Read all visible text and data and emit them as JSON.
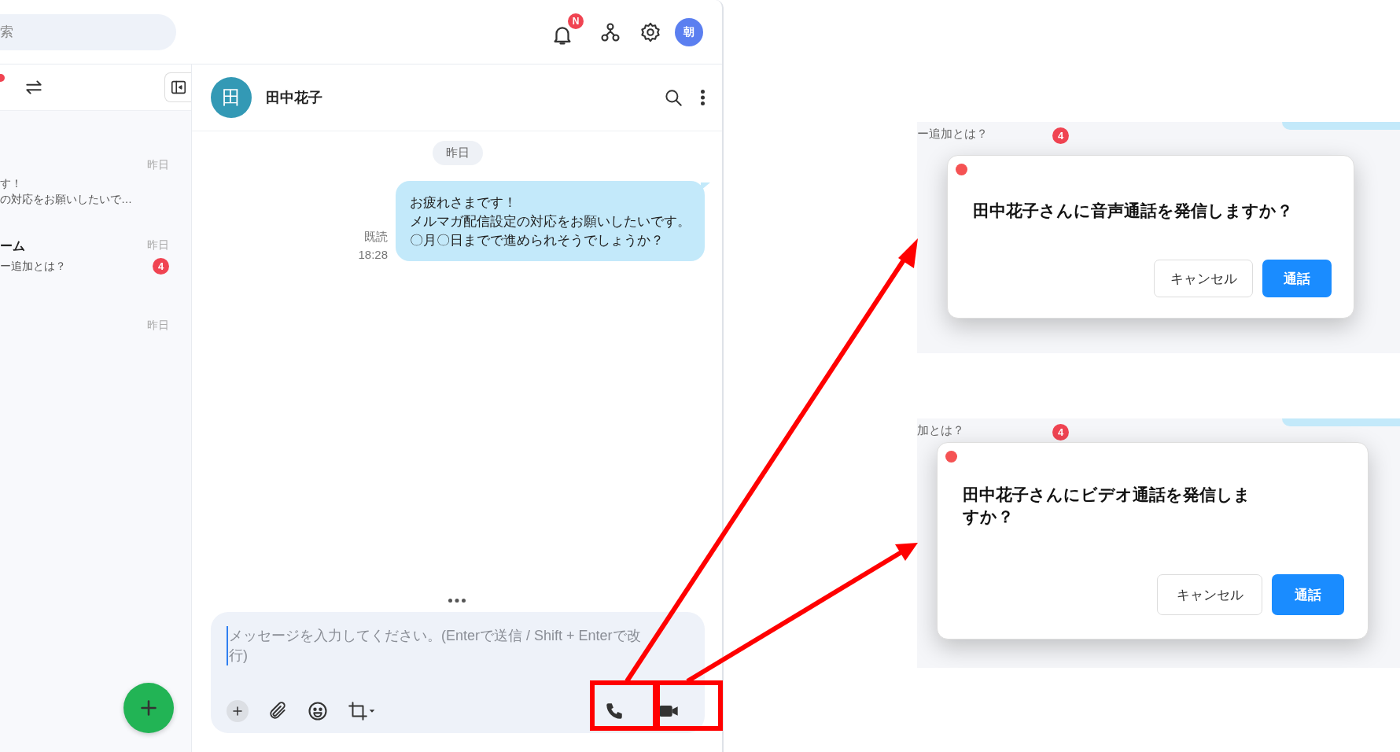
{
  "top_bar": {
    "search_placeholder": "索",
    "notification_badge": "N",
    "user_avatar": "朝"
  },
  "sidebar": {
    "conversations": [
      {
        "time": "昨日",
        "preview": [
          "す！",
          "の対応をお願いしたいで…"
        ]
      },
      {
        "name": "ーム",
        "time": "昨日",
        "preview": [
          "ー追加とは？"
        ],
        "unread": "4"
      },
      {
        "time": "昨日"
      }
    ]
  },
  "chat": {
    "name": "田中花子",
    "avatar": "田",
    "date_divider": "昨日",
    "messages": [
      {
        "read_status": "既読",
        "time": "18:28",
        "lines": [
          "お疲れさまです！",
          "メルマガ配信設定の対応をお願いしたいです。",
          "〇月〇日までで進められそうでしょうか？"
        ]
      }
    ],
    "composer": {
      "placeholder": "メッセージを入力してください。(Enterで送信 / Shift + Enterで改行)"
    }
  },
  "call_dialogs": [
    {
      "behind_preview": "ー追加とは？",
      "behind_badge": "4",
      "message": "田中花子さんに音声通話を発信しますか？",
      "cancel": "キャンセル",
      "confirm": "通話"
    },
    {
      "behind_preview": "加とは？",
      "behind_badge": "4",
      "message": "田中花子さんにビデオ通話を発信しますか？",
      "cancel": "キャンセル",
      "confirm": "通話"
    }
  ]
}
